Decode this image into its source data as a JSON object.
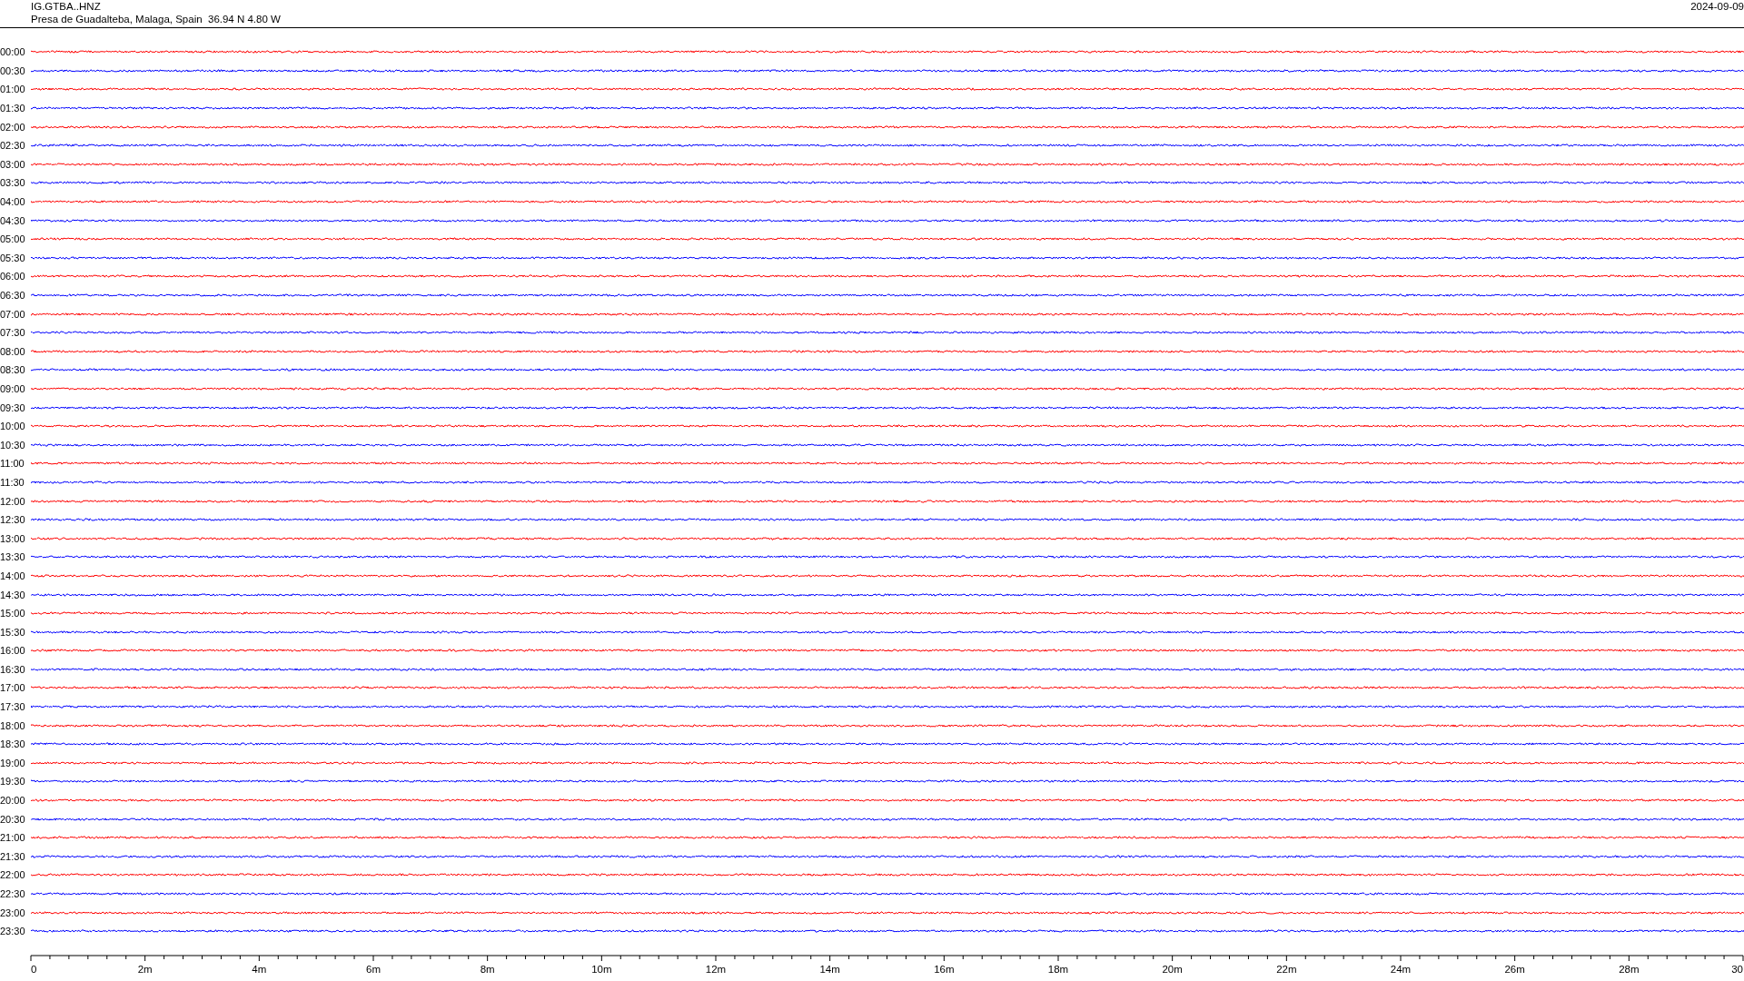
{
  "header": {
    "station": "IG.GTBA..HNZ",
    "location": "Presa de Guadalteba, Malaga, Spain  36.94 N 4.80 W",
    "date": "2024-09-09"
  },
  "rows": [
    {
      "label": "00:00",
      "color": "#ff0000"
    },
    {
      "label": "00:30",
      "color": "#0000ff"
    },
    {
      "label": "01:00",
      "color": "#ff0000"
    },
    {
      "label": "01:30",
      "color": "#0000ff"
    },
    {
      "label": "02:00",
      "color": "#ff0000"
    },
    {
      "label": "02:30",
      "color": "#0000ff"
    },
    {
      "label": "03:00",
      "color": "#ff0000"
    },
    {
      "label": "03:30",
      "color": "#0000ff"
    },
    {
      "label": "04:00",
      "color": "#ff0000"
    },
    {
      "label": "04:30",
      "color": "#0000ff"
    },
    {
      "label": "05:00",
      "color": "#ff0000"
    },
    {
      "label": "05:30",
      "color": "#0000ff"
    },
    {
      "label": "06:00",
      "color": "#ff0000"
    },
    {
      "label": "06:30",
      "color": "#0000ff"
    },
    {
      "label": "07:00",
      "color": "#ff0000"
    },
    {
      "label": "07:30",
      "color": "#0000ff"
    },
    {
      "label": "08:00",
      "color": "#ff0000"
    },
    {
      "label": "08:30",
      "color": "#0000ff"
    },
    {
      "label": "09:00",
      "color": "#ff0000"
    },
    {
      "label": "09:30",
      "color": "#0000ff"
    },
    {
      "label": "10:00",
      "color": "#ff0000"
    },
    {
      "label": "10:30",
      "color": "#0000ff"
    },
    {
      "label": "11:00",
      "color": "#ff0000"
    },
    {
      "label": "11:30",
      "color": "#0000ff"
    },
    {
      "label": "12:00",
      "color": "#ff0000"
    },
    {
      "label": "12:30",
      "color": "#0000ff"
    },
    {
      "label": "13:00",
      "color": "#ff0000"
    },
    {
      "label": "13:30",
      "color": "#0000ff"
    },
    {
      "label": "14:00",
      "color": "#ff0000"
    },
    {
      "label": "14:30",
      "color": "#0000ff"
    },
    {
      "label": "15:00",
      "color": "#ff0000"
    },
    {
      "label": "15:30",
      "color": "#0000ff"
    },
    {
      "label": "16:00",
      "color": "#ff0000"
    },
    {
      "label": "16:30",
      "color": "#0000ff"
    },
    {
      "label": "17:00",
      "color": "#ff0000"
    },
    {
      "label": "17:30",
      "color": "#0000ff"
    },
    {
      "label": "18:00",
      "color": "#ff0000"
    },
    {
      "label": "18:30",
      "color": "#0000ff"
    },
    {
      "label": "19:00",
      "color": "#ff0000"
    },
    {
      "label": "19:30",
      "color": "#0000ff"
    },
    {
      "label": "20:00",
      "color": "#ff0000"
    },
    {
      "label": "20:30",
      "color": "#0000ff"
    },
    {
      "label": "21:00",
      "color": "#ff0000"
    },
    {
      "label": "21:30",
      "color": "#0000ff"
    },
    {
      "label": "22:00",
      "color": "#ff0000"
    },
    {
      "label": "22:30",
      "color": "#0000ff"
    },
    {
      "label": "23:00",
      "color": "#ff0000"
    },
    {
      "label": "23:30",
      "color": "#0000ff"
    }
  ],
  "axis": {
    "labels": [
      "0",
      "2m",
      "4m",
      "6m",
      "8m",
      "10m",
      "12m",
      "14m",
      "16m",
      "18m",
      "20m",
      "22m",
      "24m",
      "26m",
      "28m",
      "30"
    ]
  }
}
